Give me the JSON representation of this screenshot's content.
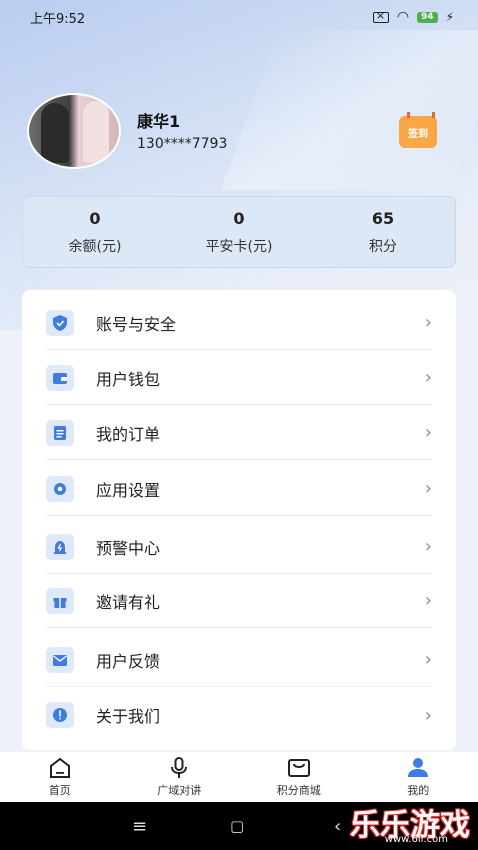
{
  "status_bar": {
    "time": "上午9:52",
    "battery": "94"
  },
  "profile": {
    "name": "康华1",
    "phone": "130****7793",
    "checkin_label": "签到"
  },
  "stats": [
    {
      "value": "0",
      "label": "余额(元)"
    },
    {
      "value": "0",
      "label": "平安卡(元)"
    },
    {
      "value": "65",
      "label": "积分"
    }
  ],
  "menu": [
    {
      "label": "账号与安全",
      "icon": "shield-icon"
    },
    {
      "label": "用户钱包",
      "icon": "wallet-icon"
    },
    {
      "label": "我的订单",
      "icon": "order-icon"
    },
    {
      "label": "应用设置",
      "icon": "gear-icon"
    },
    {
      "label": "预警中心",
      "icon": "alert-icon"
    },
    {
      "label": "邀请有礼",
      "icon": "gift-icon"
    },
    {
      "label": "用户反馈",
      "icon": "feedback-icon"
    },
    {
      "label": "关于我们",
      "icon": "info-icon"
    }
  ],
  "tabs": [
    {
      "label": "首页",
      "icon": "home-icon"
    },
    {
      "label": "广域对讲",
      "icon": "mic-icon"
    },
    {
      "label": "积分商城",
      "icon": "mall-icon"
    },
    {
      "label": "我的",
      "icon": "user-icon",
      "active": true
    }
  ],
  "watermark": {
    "text": "乐乐游戏",
    "sub": "www.6ll.com"
  },
  "colors": {
    "accent": "#3f7be0",
    "icon_bg": "#dfe9fa",
    "checkin": "#f7a745"
  }
}
